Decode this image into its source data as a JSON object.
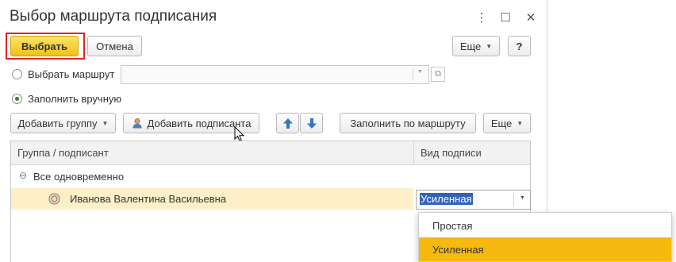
{
  "window": {
    "title": "Выбор маршрута подписания",
    "more_icon": "⋮",
    "maximize_icon": "☐",
    "close_icon": "✕"
  },
  "toolbar": {
    "select_label": "Выбрать",
    "cancel_label": "Отмена",
    "more_label": "Еще",
    "help_label": "?"
  },
  "route": {
    "choose_route_label": "Выбрать маршрут",
    "route_value": "",
    "fill_manually_label": "Заполнить вручную",
    "selected_option": "fill_manually"
  },
  "commands": {
    "add_group_label": "Добавить группу",
    "add_signer_label": "Добавить подписанта",
    "fill_by_route_label": "Заполнить по маршруту",
    "more_label": "Еще"
  },
  "table": {
    "columns": [
      "Группа / подписант",
      "Вид подписи"
    ],
    "group_row": {
      "label": "Все одновременно",
      "toggle": "⊖"
    },
    "rows": [
      {
        "signer": "Иванова Валентина Васильевна",
        "signature_type": "Усиленная"
      }
    ]
  },
  "dropdown": {
    "options": [
      "Простая",
      "Усиленная"
    ],
    "selected": "Усиленная"
  },
  "colors": {
    "primary_button": "#f1c213",
    "highlight_border": "#e02424",
    "selected_row": "#fdf0c8",
    "dropdown_active": "#f5b90f"
  }
}
